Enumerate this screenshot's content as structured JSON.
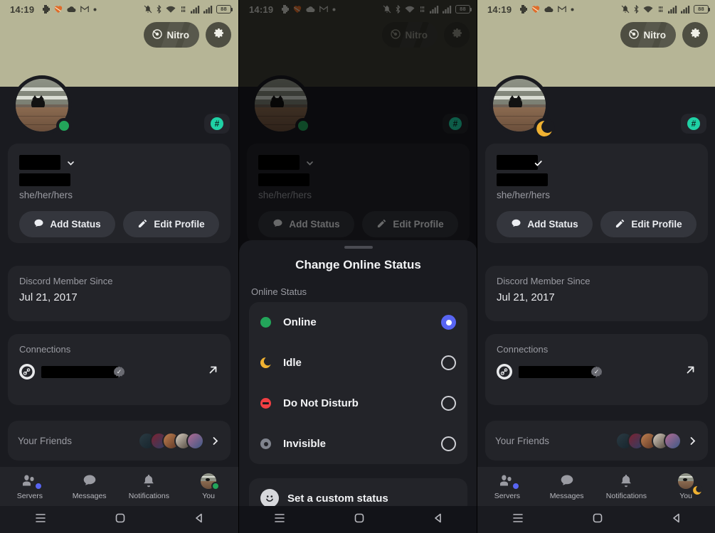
{
  "meta": {
    "app": "Discord",
    "screen": "User Profile / Change Online Status",
    "colors": {
      "banner": "#b6b596",
      "banner_dim": "#3b3b32",
      "background": "#1a1b20",
      "card": "#232429",
      "accent_blurple": "#5865f2",
      "online_green": "#23a55a",
      "idle_yellow": "#f0b232",
      "dnd_red": "#f23f43",
      "invisible_gray": "#80848e",
      "hash_teal": "#1fd1a5"
    }
  },
  "statusbar": {
    "time": "14:19",
    "left_icons": [
      "discord-icon",
      "strava-heart-icon",
      "cloud-icon",
      "gmail-icon",
      "dot-icon"
    ],
    "right_icons": [
      "notifications-muted-icon",
      "bluetooth-icon",
      "wifi-icon",
      "vibrate-icon",
      "signal-bars-icon",
      "signal-bars-2-icon"
    ],
    "battery": "88"
  },
  "topbar": {
    "nitro_label": "Nitro",
    "settings_icon": "gear-icon"
  },
  "profile": {
    "pronouns": "she/her/hers",
    "username_redacted": true,
    "displayname_redacted": true,
    "add_status_label": "Add Status",
    "edit_profile_label": "Edit Profile",
    "hash_badge": "#"
  },
  "member_card": {
    "label": "Discord Member Since",
    "value": "Jul 21, 2017"
  },
  "connections_card": {
    "label": "Connections",
    "provider": "steam-icon",
    "verified": true,
    "open_icon": "external-link-icon"
  },
  "friends_card": {
    "label": "Your Friends",
    "avatar_count": 5,
    "chevron": "chevron-right-icon"
  },
  "bottomnav": {
    "items": [
      {
        "label": "Servers",
        "icon": "servers-icon",
        "badge": true
      },
      {
        "label": "Messages",
        "icon": "messages-icon",
        "badge": false
      },
      {
        "label": "Notifications",
        "icon": "bell-icon",
        "badge": false
      },
      {
        "label": "You",
        "icon": "avatar-icon",
        "badge": false
      }
    ]
  },
  "sysnav": {
    "items": [
      "recents-icon",
      "home-icon",
      "back-icon"
    ]
  },
  "sheet": {
    "title": "Change Online Status",
    "section_label": "Online Status",
    "options": [
      {
        "label": "Online",
        "icon": "status-online-icon",
        "selected": true
      },
      {
        "label": "Idle",
        "icon": "status-idle-icon",
        "selected": false
      },
      {
        "label": "Do Not Disturb",
        "icon": "status-dnd-icon",
        "selected": false
      },
      {
        "label": "Invisible",
        "icon": "status-invisible-icon",
        "selected": false
      }
    ],
    "custom_status_label": "Set a custom status",
    "custom_status_icon": "smiley-icon"
  },
  "panels": [
    {
      "id": "left",
      "state": "online",
      "dimmed": false
    },
    {
      "id": "middle",
      "state": "online",
      "dimmed": true,
      "sheet_open": true
    },
    {
      "id": "right",
      "state": "idle",
      "dimmed": false
    }
  ]
}
